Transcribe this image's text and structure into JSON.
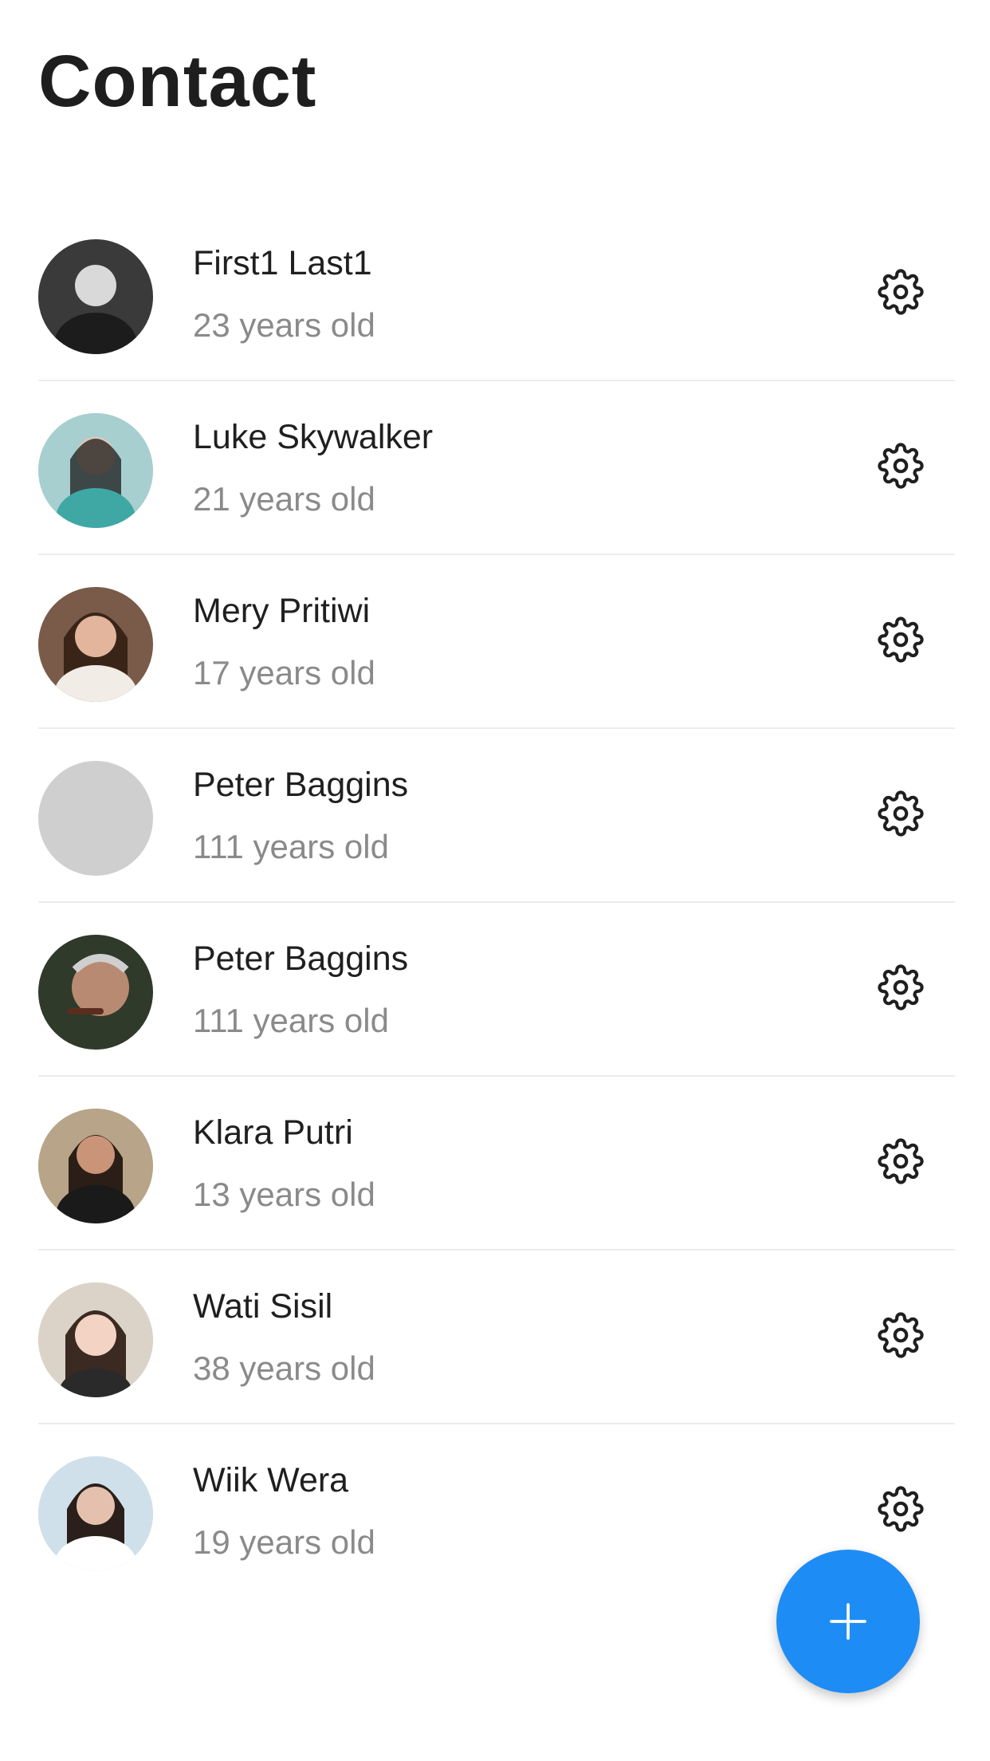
{
  "header": {
    "title": "Contact"
  },
  "contacts": [
    {
      "name": "First1 Last1",
      "age": "23 years old",
      "avatar": "photo",
      "tone": "#3a3a3a"
    },
    {
      "name": "Luke Skywalker",
      "age": "21 years old",
      "avatar": "photo",
      "tone": "#5fa7a6"
    },
    {
      "name": "Mery Pritiwi",
      "age": "17 years old",
      "avatar": "photo",
      "tone": "#9a6a55"
    },
    {
      "name": "Peter Baggins",
      "age": "111 years old",
      "avatar": "placeholder",
      "tone": "#cfcfcf"
    },
    {
      "name": "Peter Baggins",
      "age": "111 years old",
      "avatar": "photo",
      "tone": "#6b4a3a"
    },
    {
      "name": "Klara Putri",
      "age": "13 years old",
      "avatar": "photo",
      "tone": "#8c7a62"
    },
    {
      "name": "Wati Sisil",
      "age": "38 years old",
      "avatar": "photo",
      "tone": "#b89a86"
    },
    {
      "name": "Wiik Wera",
      "age": "19 years old",
      "avatar": "photo",
      "tone": "#c7b3ad"
    }
  ],
  "icons": {
    "row_action": "gear-icon",
    "fab": "plus-icon"
  },
  "colors": {
    "accent": "#1e8cf5",
    "name_text": "#1f1f1f",
    "age_text": "#8a8a8a",
    "divider": "#ececec",
    "placeholder_avatar": "#cfcfcf"
  }
}
